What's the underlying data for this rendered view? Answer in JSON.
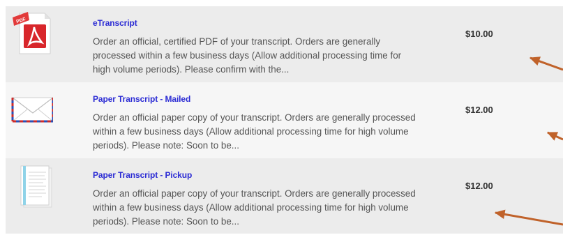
{
  "products": [
    {
      "icon": "pdf-icon",
      "title": "eTranscript",
      "description": "Order an official, certified PDF of your transcript. Orders are generally processed within a few business days (Allow additional processing time for high volume periods). Please confirm with the...",
      "price": "$10.00"
    },
    {
      "icon": "envelope-icon",
      "title": "Paper Transcript - Mailed",
      "description": "Order an official paper copy of your transcript. Orders are generally processed within a few business days (Allow additional processing time for high volume periods). Please note: Soon to be...",
      "price": "$12.00"
    },
    {
      "icon": "paper-document-icon",
      "title": "Paper Transcript - Pickup",
      "description": "Order an official paper copy of your transcript. Orders are generally processed within a few business days (Allow additional processing time for high volume periods). Please note: Soon to be...",
      "price": "$12.00"
    }
  ],
  "annotation": {
    "arrow_color": "#c0622a"
  }
}
